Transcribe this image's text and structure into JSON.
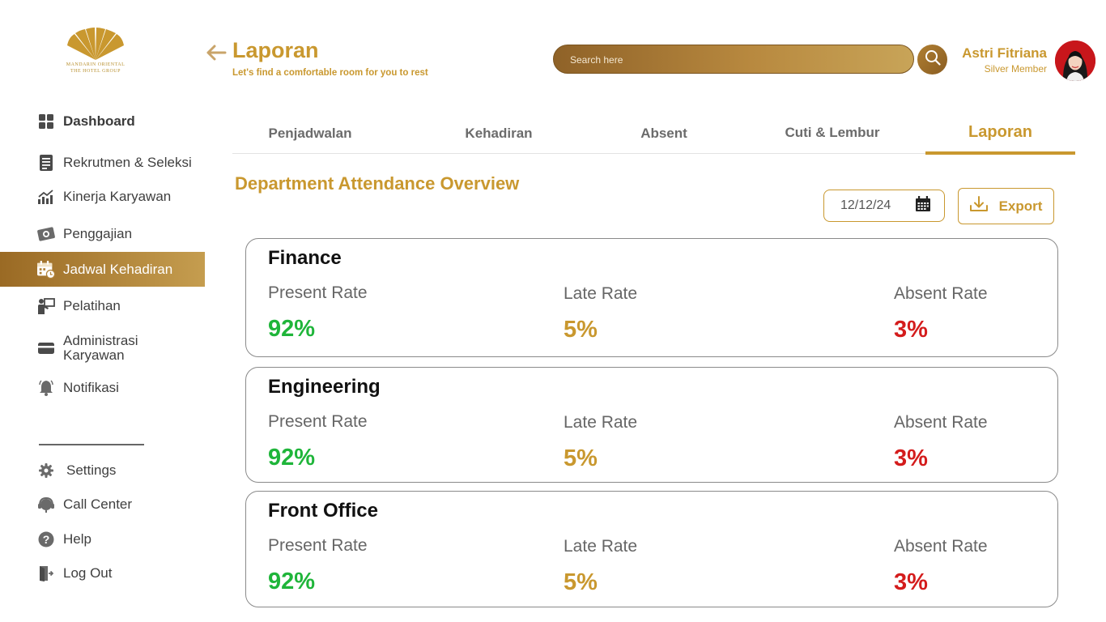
{
  "brand": {
    "name_line1": "MANDARIN ORIENTAL",
    "name_line2": "THE HOTEL GROUP"
  },
  "sidebar": {
    "items": [
      {
        "label": "Dashboard",
        "icon": "grid-icon"
      },
      {
        "label": "Rekrutmen & Seleksi",
        "icon": "clipboard-icon"
      },
      {
        "label": "Kinerja Karyawan",
        "icon": "chart-growth-icon"
      },
      {
        "label": "Penggajian",
        "icon": "money-icon"
      },
      {
        "label": "Jadwal Kehadiran",
        "icon": "calendar-clock-icon"
      },
      {
        "label": "Pelatihan",
        "icon": "training-icon"
      },
      {
        "label": "Administrasi\nKaryawan",
        "icon": "card-icon"
      },
      {
        "label": "Notifikasi",
        "icon": "bell-icon"
      }
    ],
    "footer": [
      {
        "label": "Settings",
        "icon": "gear-icon"
      },
      {
        "label": "Call Center",
        "icon": "headset-icon"
      },
      {
        "label": "Help",
        "icon": "help-icon"
      },
      {
        "label": "Log Out",
        "icon": "logout-icon"
      }
    ]
  },
  "header": {
    "title": "Laporan",
    "subtitle": "Let's find a comfortable room for you to rest",
    "search_placeholder": "Search here",
    "user_name": "Astri Fitriana",
    "user_tier": "Silver Member"
  },
  "tabs": [
    {
      "label": "Penjadwalan"
    },
    {
      "label": "Kehadiran"
    },
    {
      "label": "Absent"
    },
    {
      "label": "Cuti & Lembur"
    },
    {
      "label": "Laporan"
    }
  ],
  "report": {
    "title": "Department Attendance Overview",
    "date": "12/12/24",
    "export_label": "Export",
    "metric_labels": {
      "present": "Present Rate",
      "late": "Late Rate",
      "absent": "Absent Rate"
    },
    "departments": [
      {
        "name": "Finance",
        "present": "92%",
        "late": "5%",
        "absent": "3%"
      },
      {
        "name": "Engineering",
        "present": "92%",
        "late": "5%",
        "absent": "3%"
      },
      {
        "name": "Front Office",
        "present": "92%",
        "late": "5%",
        "absent": "3%"
      }
    ]
  },
  "colors": {
    "accent": "#c9982f",
    "present": "#1fb53a",
    "late": "#c9982f",
    "absent": "#d41c1c"
  }
}
